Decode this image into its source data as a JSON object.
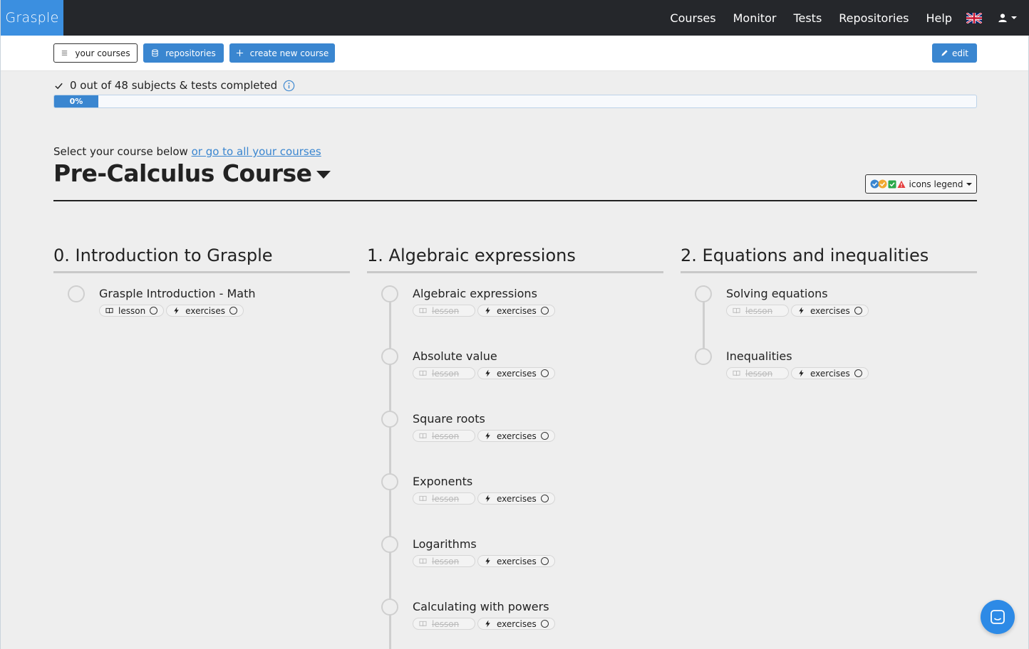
{
  "brand": "Grasple",
  "nav": {
    "links": [
      "Courses",
      "Monitor",
      "Tests",
      "Repositories",
      "Help"
    ],
    "language_icon": "uk-flag-icon",
    "user_icon": "user-icon"
  },
  "toolbar": {
    "your_courses": "your courses",
    "repositories": "repositories",
    "create_new_course": "create new course",
    "edit": "edit"
  },
  "progress": {
    "label": "0 out of 48 subjects & tests completed",
    "percent_label": "0%",
    "percent": 0
  },
  "course": {
    "select_text": "Select your course below ",
    "select_link": "or go to all your courses",
    "title": "Pre-Calculus Course",
    "legend_label": "icons legend"
  },
  "chapters": [
    {
      "title": "0. Introduction to Grasple",
      "subjects": [
        {
          "title": "Grasple Introduction - Math",
          "lesson": "lesson",
          "lesson_enabled": true,
          "exercises": "exercises"
        }
      ]
    },
    {
      "title": "1. Algebraic expressions",
      "subjects": [
        {
          "title": "Algebraic expressions",
          "lesson": "lesson",
          "lesson_enabled": false,
          "exercises": "exercises"
        },
        {
          "title": "Absolute value",
          "lesson": "lesson",
          "lesson_enabled": false,
          "exercises": "exercises"
        },
        {
          "title": "Square roots",
          "lesson": "lesson",
          "lesson_enabled": false,
          "exercises": "exercises"
        },
        {
          "title": "Exponents",
          "lesson": "lesson",
          "lesson_enabled": false,
          "exercises": "exercises"
        },
        {
          "title": "Logarithms",
          "lesson": "lesson",
          "lesson_enabled": false,
          "exercises": "exercises"
        },
        {
          "title": "Calculating with powers",
          "lesson": "lesson",
          "lesson_enabled": false,
          "exercises": "exercises"
        }
      ]
    },
    {
      "title": "2. Equations and inequalities",
      "subjects": [
        {
          "title": "Solving equations",
          "lesson": "lesson",
          "lesson_enabled": false,
          "exercises": "exercises"
        },
        {
          "title": "Inequalities",
          "lesson": "lesson",
          "lesson_enabled": false,
          "exercises": "exercises"
        }
      ]
    }
  ],
  "colors": {
    "brand_blue": "#3b8fe0",
    "navbar": "#25272b",
    "button_blue": "#3a86d0"
  }
}
